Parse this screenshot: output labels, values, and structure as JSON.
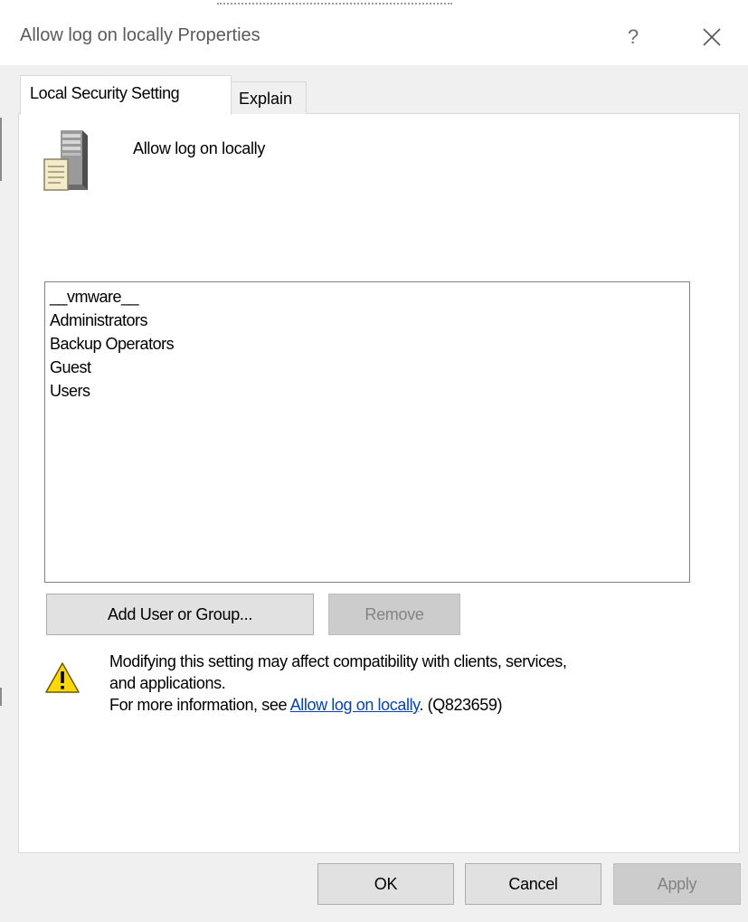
{
  "window": {
    "title": "Allow log on locally Properties",
    "help_label": "?",
    "close_icon": "close-icon"
  },
  "tabs": [
    {
      "label": "Local Security Setting",
      "selected": true
    },
    {
      "label": "Explain",
      "selected": false
    }
  ],
  "policy": {
    "icon": "server-document-icon",
    "name": "Allow log on locally"
  },
  "members": [
    "__vmware__",
    "Administrators",
    "Backup Operators",
    "Guest",
    "Users"
  ],
  "actions": {
    "add_label": "Add User or Group...",
    "remove_label": "Remove",
    "remove_enabled": false
  },
  "warning": {
    "icon": "warning-icon",
    "line1": "Modifying this setting may affect compatibility with clients, services,",
    "line2": "and applications.",
    "info_prefix": "For more information, see ",
    "link_text": "Allow log on locally",
    "info_suffix": ". (Q823659)"
  },
  "footer": {
    "ok_label": "OK",
    "cancel_label": "Cancel",
    "apply_label": "Apply",
    "apply_enabled": false
  },
  "colors": {
    "dialog_bg": "#f0f0f0",
    "panel_bg": "#ffffff",
    "link": "#0645ad",
    "warning_yellow": "#ffd800"
  }
}
